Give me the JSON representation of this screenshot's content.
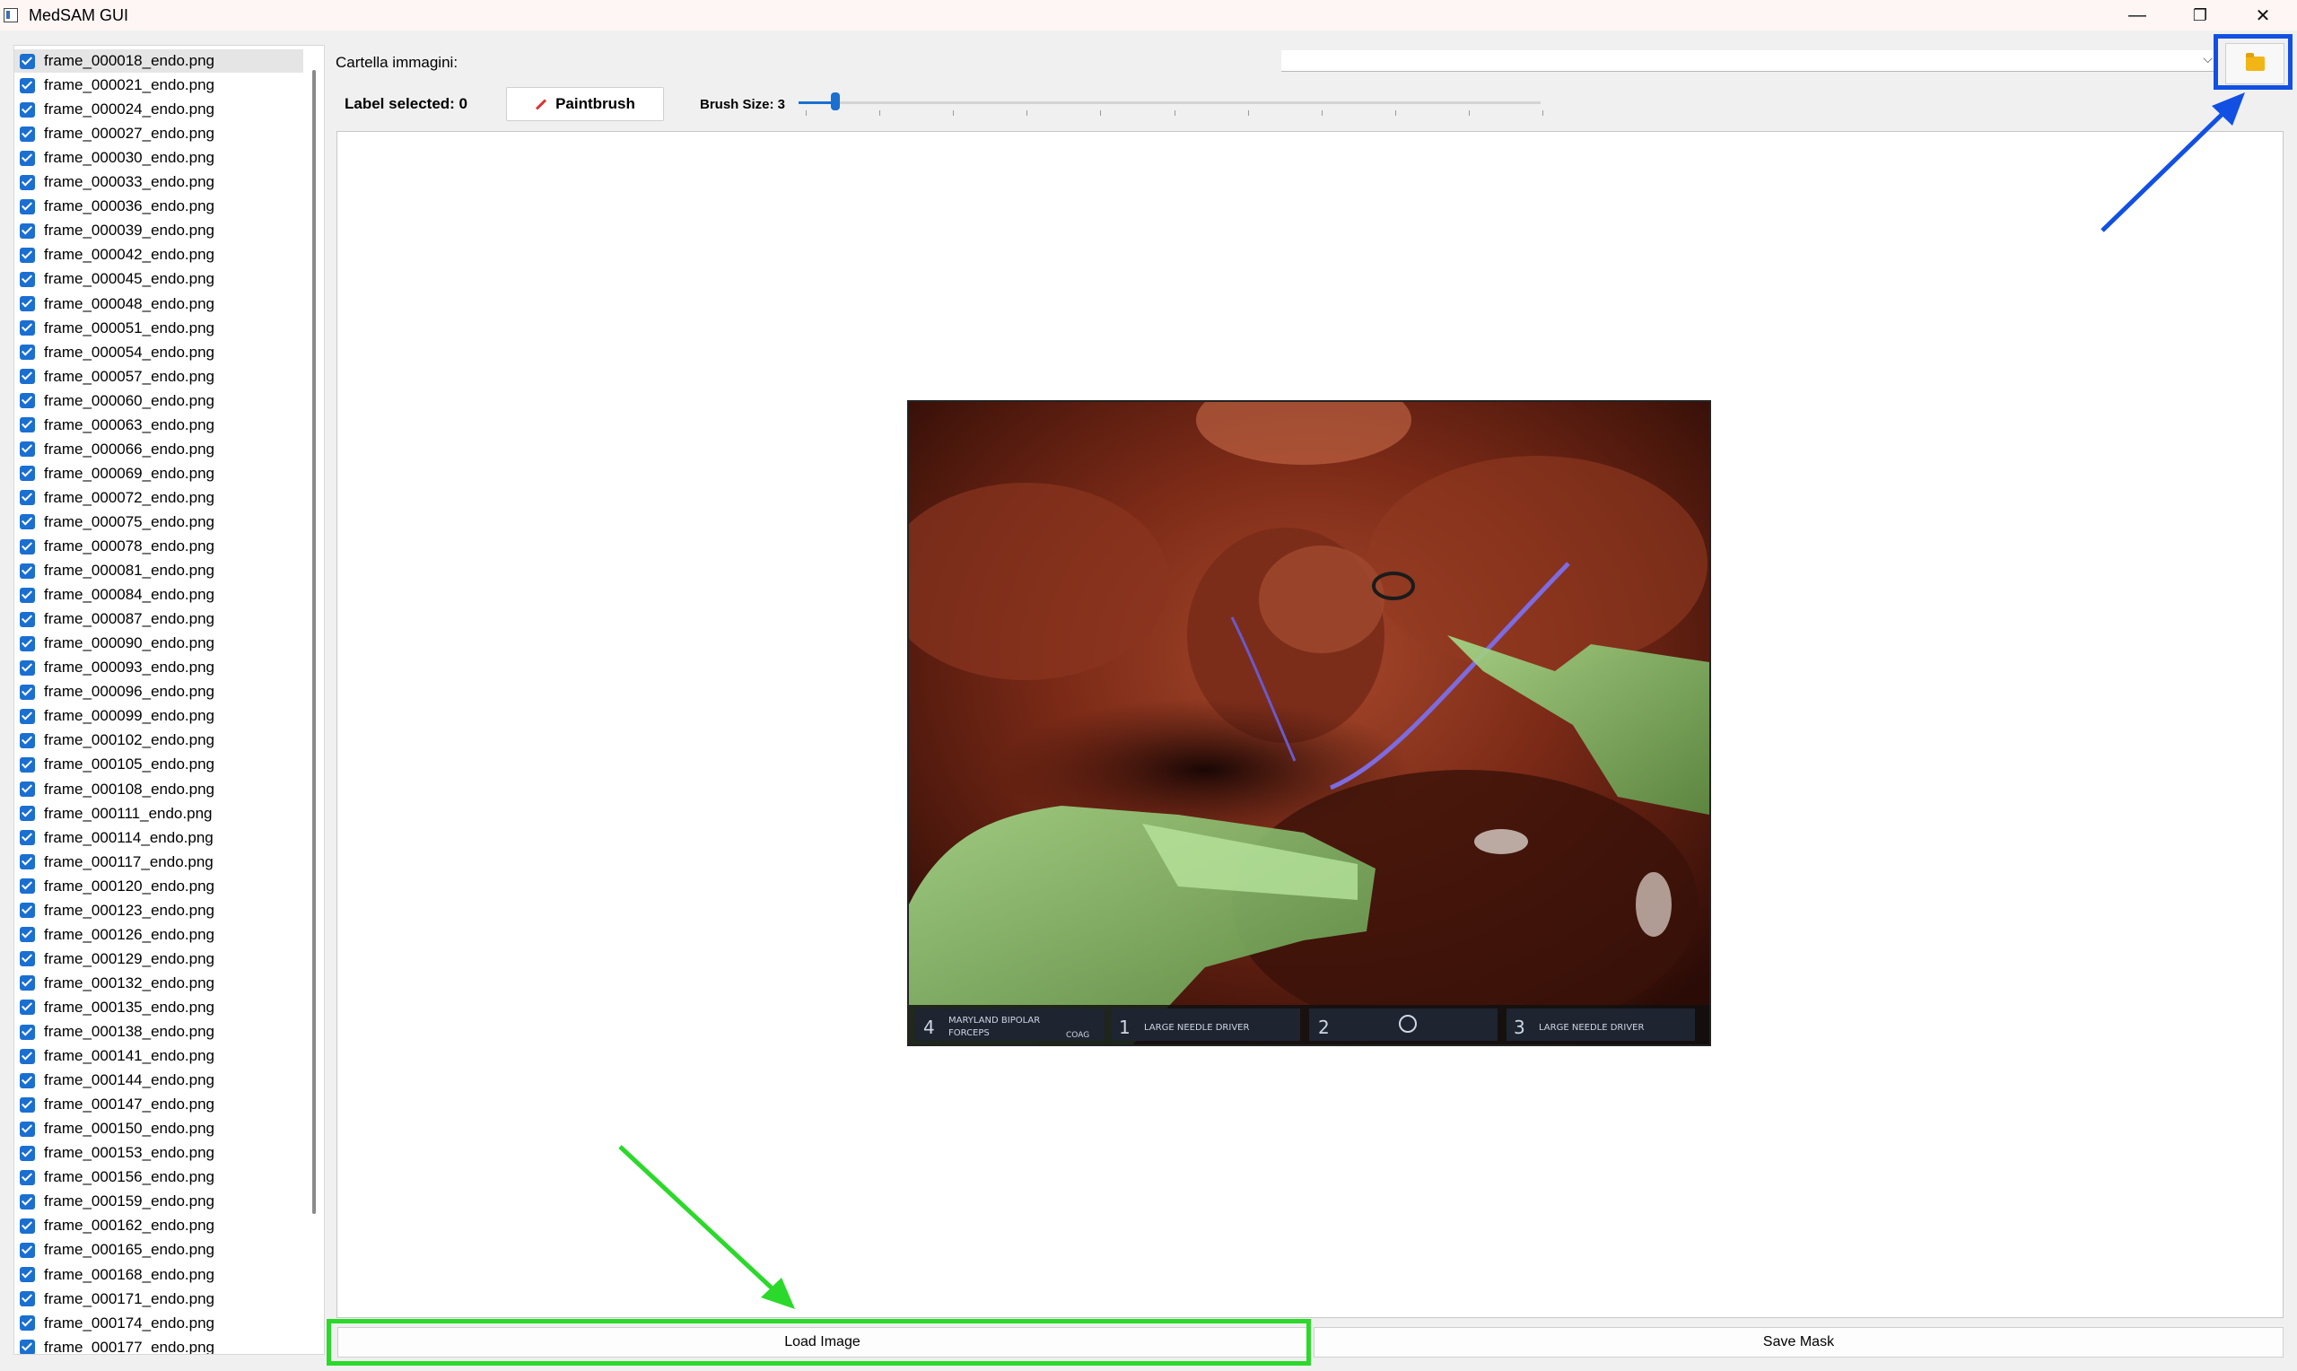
{
  "window": {
    "title": "MedSAM GUI",
    "minimize_glyph": "—",
    "maximize_glyph": "❐",
    "close_glyph": "✕"
  },
  "sidebar": {
    "files": [
      {
        "name": "frame_000018_endo.png",
        "checked": true,
        "selected": true
      },
      {
        "name": "frame_000021_endo.png",
        "checked": true
      },
      {
        "name": "frame_000024_endo.png",
        "checked": true
      },
      {
        "name": "frame_000027_endo.png",
        "checked": true
      },
      {
        "name": "frame_000030_endo.png",
        "checked": true
      },
      {
        "name": "frame_000033_endo.png",
        "checked": true
      },
      {
        "name": "frame_000036_endo.png",
        "checked": true
      },
      {
        "name": "frame_000039_endo.png",
        "checked": true
      },
      {
        "name": "frame_000042_endo.png",
        "checked": true
      },
      {
        "name": "frame_000045_endo.png",
        "checked": true
      },
      {
        "name": "frame_000048_endo.png",
        "checked": true
      },
      {
        "name": "frame_000051_endo.png",
        "checked": true
      },
      {
        "name": "frame_000054_endo.png",
        "checked": true
      },
      {
        "name": "frame_000057_endo.png",
        "checked": true
      },
      {
        "name": "frame_000060_endo.png",
        "checked": true
      },
      {
        "name": "frame_000063_endo.png",
        "checked": true
      },
      {
        "name": "frame_000066_endo.png",
        "checked": true
      },
      {
        "name": "frame_000069_endo.png",
        "checked": true
      },
      {
        "name": "frame_000072_endo.png",
        "checked": true
      },
      {
        "name": "frame_000075_endo.png",
        "checked": true
      },
      {
        "name": "frame_000078_endo.png",
        "checked": true
      },
      {
        "name": "frame_000081_endo.png",
        "checked": true
      },
      {
        "name": "frame_000084_endo.png",
        "checked": true
      },
      {
        "name": "frame_000087_endo.png",
        "checked": true
      },
      {
        "name": "frame_000090_endo.png",
        "checked": true
      },
      {
        "name": "frame_000093_endo.png",
        "checked": true
      },
      {
        "name": "frame_000096_endo.png",
        "checked": true
      },
      {
        "name": "frame_000099_endo.png",
        "checked": true
      },
      {
        "name": "frame_000102_endo.png",
        "checked": true
      },
      {
        "name": "frame_000105_endo.png",
        "checked": true
      },
      {
        "name": "frame_000108_endo.png",
        "checked": true
      },
      {
        "name": "frame_000111_endo.png",
        "checked": true
      },
      {
        "name": "frame_000114_endo.png",
        "checked": true
      },
      {
        "name": "frame_000117_endo.png",
        "checked": true
      },
      {
        "name": "frame_000120_endo.png",
        "checked": true
      },
      {
        "name": "frame_000123_endo.png",
        "checked": true
      },
      {
        "name": "frame_000126_endo.png",
        "checked": true
      },
      {
        "name": "frame_000129_endo.png",
        "checked": true
      },
      {
        "name": "frame_000132_endo.png",
        "checked": true
      },
      {
        "name": "frame_000135_endo.png",
        "checked": true
      },
      {
        "name": "frame_000138_endo.png",
        "checked": true
      },
      {
        "name": "frame_000141_endo.png",
        "checked": true
      },
      {
        "name": "frame_000144_endo.png",
        "checked": true
      },
      {
        "name": "frame_000147_endo.png",
        "checked": true
      },
      {
        "name": "frame_000150_endo.png",
        "checked": true
      },
      {
        "name": "frame_000153_endo.png",
        "checked": true
      },
      {
        "name": "frame_000156_endo.png",
        "checked": true
      },
      {
        "name": "frame_000159_endo.png",
        "checked": true
      },
      {
        "name": "frame_000162_endo.png",
        "checked": true
      },
      {
        "name": "frame_000165_endo.png",
        "checked": true
      },
      {
        "name": "frame_000168_endo.png",
        "checked": true
      },
      {
        "name": "frame_000171_endo.png",
        "checked": true
      },
      {
        "name": "frame_000174_endo.png",
        "checked": true
      },
      {
        "name": "frame_000177_endo.png",
        "checked": true
      }
    ]
  },
  "toolbar": {
    "folder_label": "Cartella immagini:",
    "folder_value": "",
    "combo_chevron": "⌵",
    "label_selected": "Label selected: 0",
    "paintbrush_label": "Paintbrush",
    "brush_size_label": "Brush Size: 3",
    "brush_slider_level": 0.05,
    "tick_count": 11
  },
  "image_overlay": {
    "hud": [
      {
        "num": "4",
        "text": "MARYLAND BIPOLAR",
        "text2": "FORCEPS",
        "extra": "COAG"
      },
      {
        "num": "1",
        "text": "LARGE NEEDLE DRIVER"
      },
      {
        "num": "2",
        "text": ""
      },
      {
        "num": "3",
        "text": "LARGE NEEDLE DRIVER"
      }
    ]
  },
  "buttons": {
    "load_image": "Load Image",
    "save_mask": "Save Mask"
  },
  "colors": {
    "accent": "#1a6fd1",
    "highlight_blue": "#1150e3",
    "highlight_green": "#2bd92b",
    "folder_icon": "#f2b516"
  }
}
